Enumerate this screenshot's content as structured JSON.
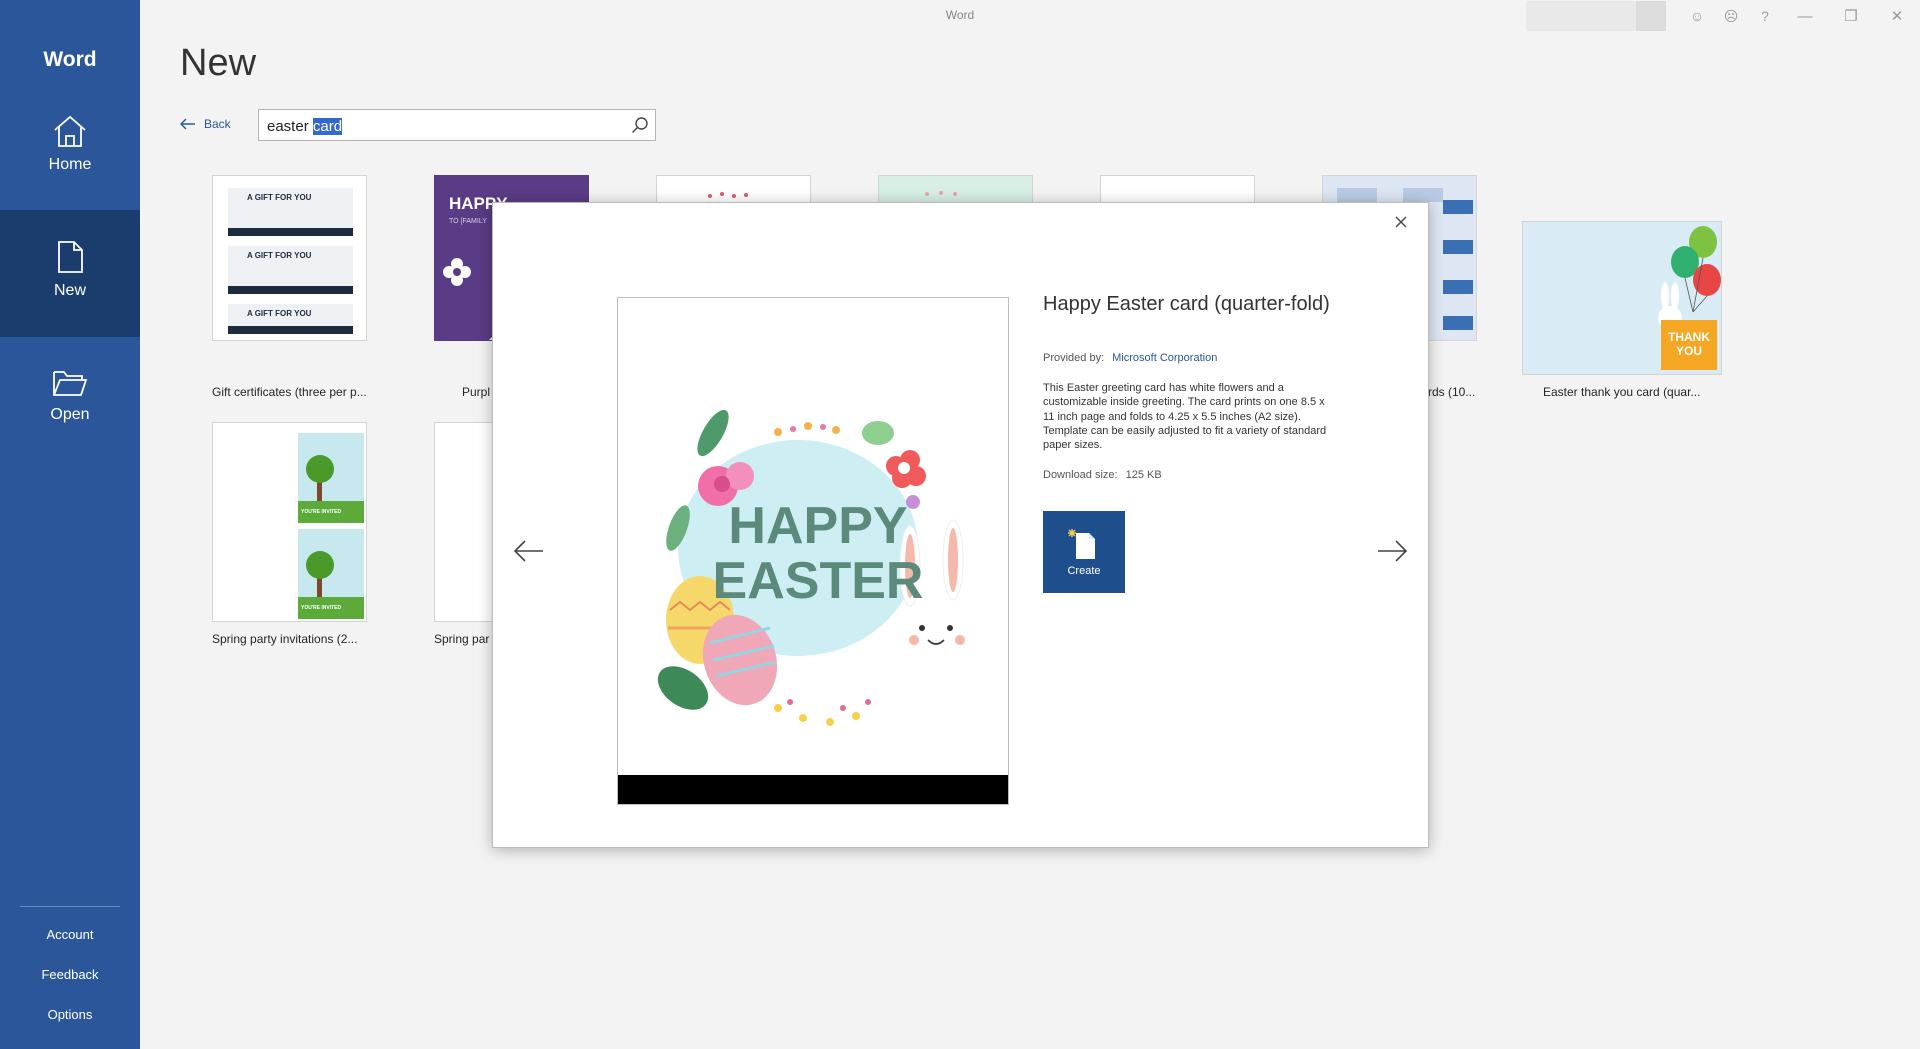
{
  "window": {
    "title": "Word"
  },
  "sidebar": {
    "app_name": "Word",
    "items": [
      {
        "label": "Home",
        "icon": "home-icon"
      },
      {
        "label": "New",
        "icon": "new-document-icon",
        "selected": true
      },
      {
        "label": "Open",
        "icon": "folder-open-icon"
      }
    ],
    "bottom": {
      "account": "Account",
      "feedback": "Feedback",
      "options": "Options"
    }
  },
  "main": {
    "heading": "New",
    "back_label": "Back",
    "search": {
      "value": "easter card",
      "selected_part": "card"
    },
    "templates": [
      {
        "label": "Gift certificates (three per p..."
      },
      {
        "label": "Purpl"
      },
      {
        "label": ""
      },
      {
        "label": ""
      },
      {
        "label": ""
      },
      {
        "label": "rds (10..."
      },
      {
        "label": "Easter thank you card (quar..."
      },
      {
        "label": "Spring party invitations (2..."
      },
      {
        "label": "Spring par"
      }
    ],
    "tile_text": {
      "gift_header": "A GIFT FOR YOU",
      "purple_word": "HAPPY",
      "purple_sub": "TO [FAMILY",
      "thank_you": "THANK YOU",
      "invited": "YOU'RE INVITED"
    }
  },
  "dialog": {
    "title": "Happy Easter card (quarter-fold)",
    "provided_by_label": "Provided by:",
    "provider": "Microsoft Corporation",
    "description": "This Easter greeting card has white flowers and a customizable inside greeting. The card prints on one 8.5 x 11 inch page and folds to 4.25 x 5.5 inches (A2 size). Template can be easily adjusted to fit a variety of standard paper sizes.",
    "download_size_label": "Download size:",
    "download_size": "125 KB",
    "create_label": "Create",
    "preview_text": {
      "line1": "HAPPY",
      "line2": "EASTER"
    }
  },
  "colors": {
    "accent": "#2b579a",
    "sidebar_selected": "#1b3d6e",
    "create_button": "#1f4e8c"
  }
}
